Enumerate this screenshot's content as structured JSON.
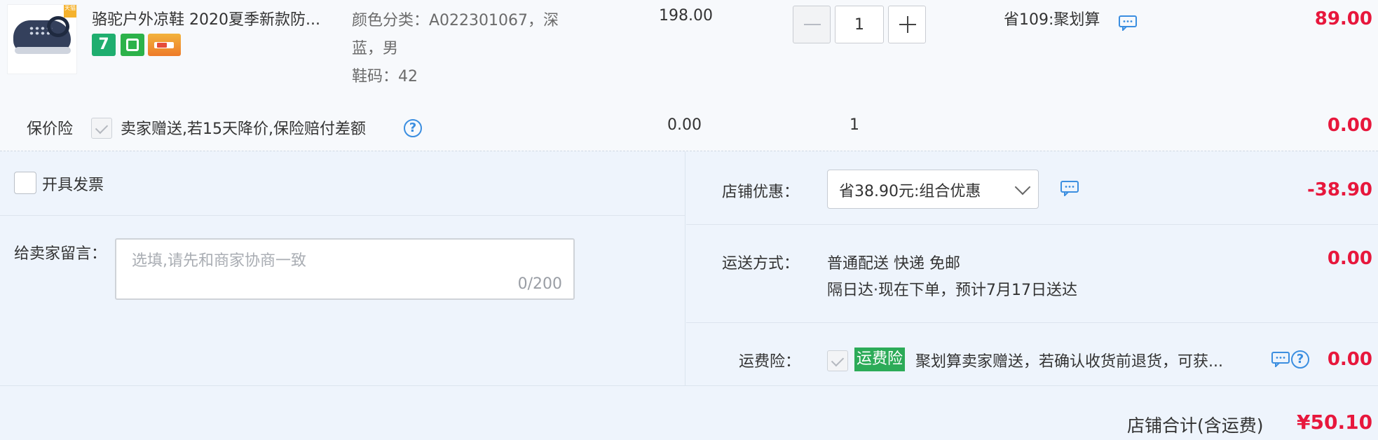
{
  "product": {
    "title": "骆驼户外凉鞋 2020夏季新款防...",
    "sku_color": "颜色分类：A022301067，深蓝，男",
    "sku_size": "鞋码：42",
    "unit_price": "198.00",
    "quantity": "1",
    "promo": "省109:聚划算",
    "subtotal": "89.00",
    "badges": [
      "7",
      "bag-icon",
      "card-icon"
    ],
    "thumbnail_corner": "天猫"
  },
  "insurance": {
    "label": "保价险",
    "text": "卖家赠送,若15天降价,保险赔付差额",
    "price": "0.00",
    "qty": "1",
    "total": "0.00",
    "checked": true
  },
  "invoice": {
    "label": "开具发票",
    "checked": false
  },
  "message": {
    "label": "给卖家留言：",
    "placeholder": "选填,请先和商家协商一致",
    "counter": "0/200"
  },
  "shop_discount": {
    "label": "店铺优惠：",
    "selected": "省38.90元:组合优惠",
    "amount": "-38.90"
  },
  "shipping": {
    "label": "运送方式：",
    "method": "普通配送 快递 免邮",
    "eta": "隔日达·现在下单，预计7月17日送达",
    "amount": "0.00"
  },
  "freight_insurance": {
    "label": "运费险：",
    "badge": "运费险",
    "text": "聚划算卖家赠送，若确认收货前退货，可获...",
    "amount": "0.00",
    "checked": true
  },
  "shop_total": {
    "label": "店铺合计(含运费)",
    "amount": "¥50.10"
  },
  "colors": {
    "price_red": "#e7173c",
    "link_blue": "#3b8ee0",
    "badge_green": "#2cab58",
    "section_bg": "#eef4fc"
  }
}
